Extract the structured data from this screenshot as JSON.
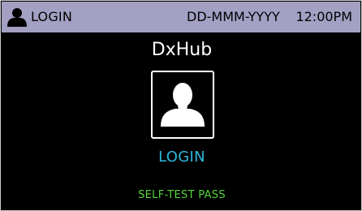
{
  "status_bar": {
    "mode_label": "LOGIN",
    "mode_icon": "user-icon",
    "date": "DD-MMM-YYYY",
    "time": "12:00PM",
    "background_color": "#a3a0c4"
  },
  "main": {
    "title": "DxHub",
    "login_tile_icon": "user-silhouette-icon",
    "login_label": "LOGIN",
    "self_test": "SELF-TEST PASS"
  },
  "colors": {
    "screen_background": "#000000",
    "login_label": "#2fb8dc",
    "self_test": "#55d63a"
  }
}
